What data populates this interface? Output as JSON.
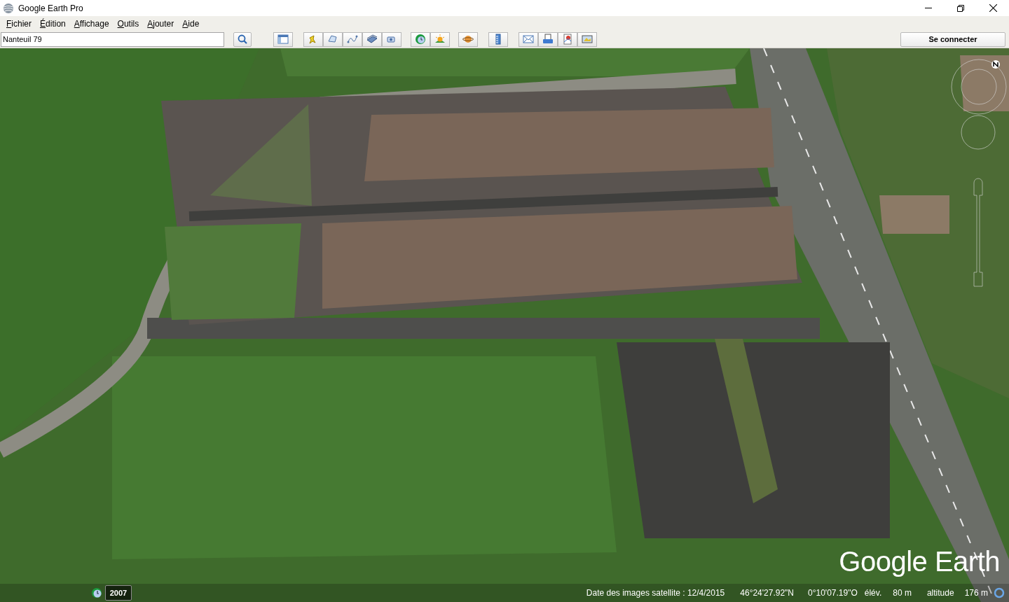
{
  "window": {
    "title": "Google Earth Pro"
  },
  "menu": [
    {
      "label": "Fichier"
    },
    {
      "label": "Édition"
    },
    {
      "label": "Affichage"
    },
    {
      "label": "Outils"
    },
    {
      "label": "Ajouter"
    },
    {
      "label": "Aide"
    }
  ],
  "search": {
    "value": "Nanteuil 79"
  },
  "sign_in": {
    "label": "Se connecter"
  },
  "map": {
    "logo": "Google Earth",
    "time_year": "2007"
  },
  "status_bar": {
    "imagery_date": "Date des images satellite : 12/4/2015",
    "latitude": "46°24'27.92\"N",
    "longitude": "0°10'07.19\"O",
    "elevation_label": "élév.",
    "elevation": "80 m",
    "altitude_label": "altitude",
    "altitude": "176 m"
  }
}
